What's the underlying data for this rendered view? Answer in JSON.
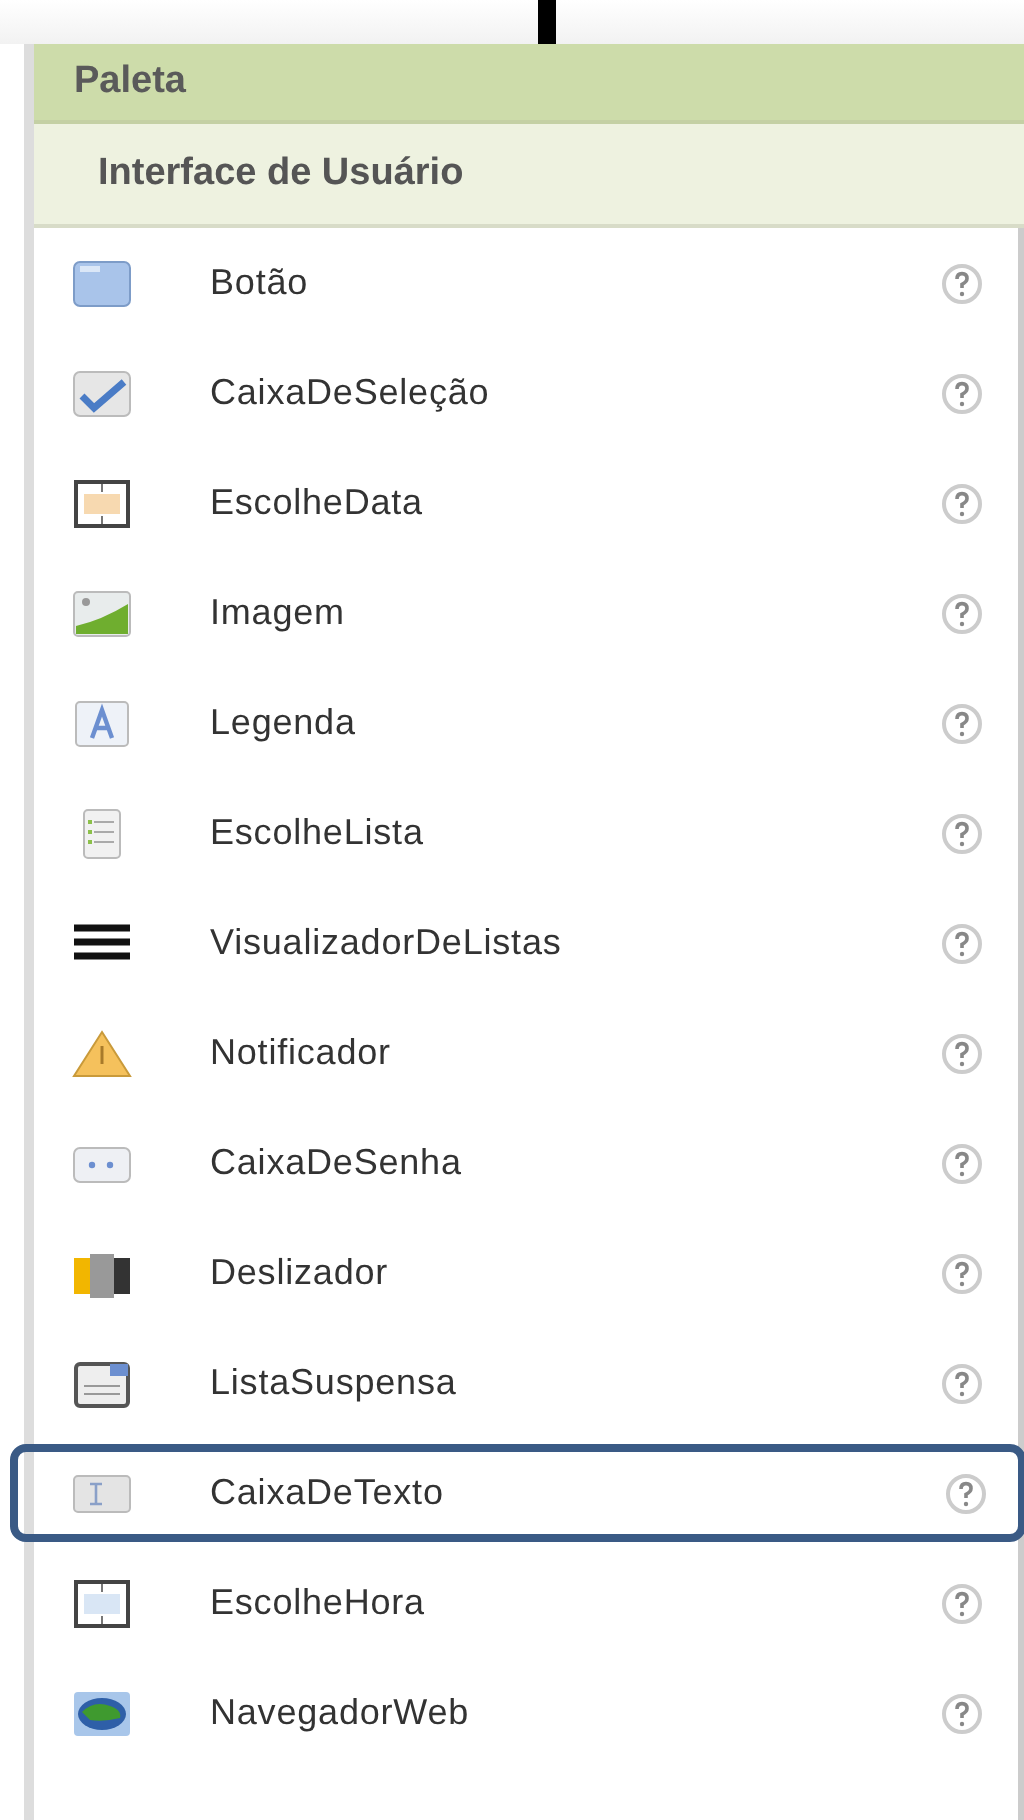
{
  "palette": {
    "title": "Paleta",
    "section": "Interface de Usuário",
    "items": [
      {
        "label": "Botão",
        "kind": "button",
        "selected": false
      },
      {
        "label": "CaixaDeSeleção",
        "kind": "checkbox",
        "selected": false
      },
      {
        "label": "EscolheData",
        "kind": "date",
        "selected": false
      },
      {
        "label": "Imagem",
        "kind": "image",
        "selected": false
      },
      {
        "label": "Legenda",
        "kind": "label",
        "selected": false
      },
      {
        "label": "EscolheLista",
        "kind": "listpicker",
        "selected": false
      },
      {
        "label": "VisualizadorDeListas",
        "kind": "listview",
        "selected": false
      },
      {
        "label": "Notificador",
        "kind": "notifier",
        "selected": false
      },
      {
        "label": "CaixaDeSenha",
        "kind": "password",
        "selected": false
      },
      {
        "label": "Deslizador",
        "kind": "slider",
        "selected": false
      },
      {
        "label": "ListaSuspensa",
        "kind": "spinner",
        "selected": false
      },
      {
        "label": "CaixaDeTexto",
        "kind": "textbox",
        "selected": true
      },
      {
        "label": "EscolheHora",
        "kind": "time",
        "selected": false
      },
      {
        "label": "NavegadorWeb",
        "kind": "web",
        "selected": false
      }
    ]
  }
}
